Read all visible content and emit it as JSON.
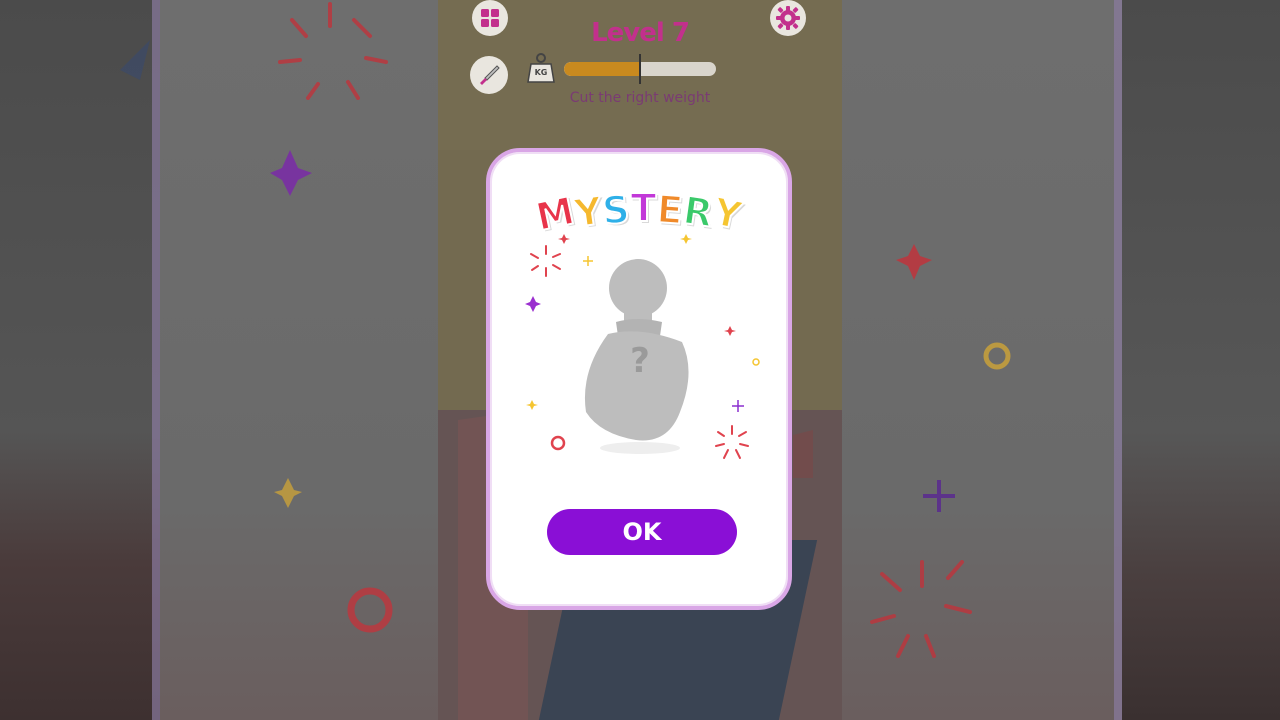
{
  "hud": {
    "level_title": "Level 7",
    "weight_icon_label": "KG",
    "hint": "Cut the right weight",
    "weight_progress": 0.5
  },
  "modal": {
    "title_letters": [
      "M",
      "Y",
      "S",
      "T",
      "E",
      "R",
      "Y"
    ],
    "title_colors": [
      "#e8344a",
      "#f5b82e",
      "#2fb0e8",
      "#c238d8",
      "#f08a2a",
      "#3ac96a",
      "#f5c531"
    ],
    "ok_label": "OK",
    "accent": "#8a0fd6"
  },
  "icons": [
    "grid-menu-icon",
    "gear-icon",
    "knife-icon",
    "weight-icon",
    "mystery-weight-silhouette-icon",
    "question-mark-icon"
  ]
}
